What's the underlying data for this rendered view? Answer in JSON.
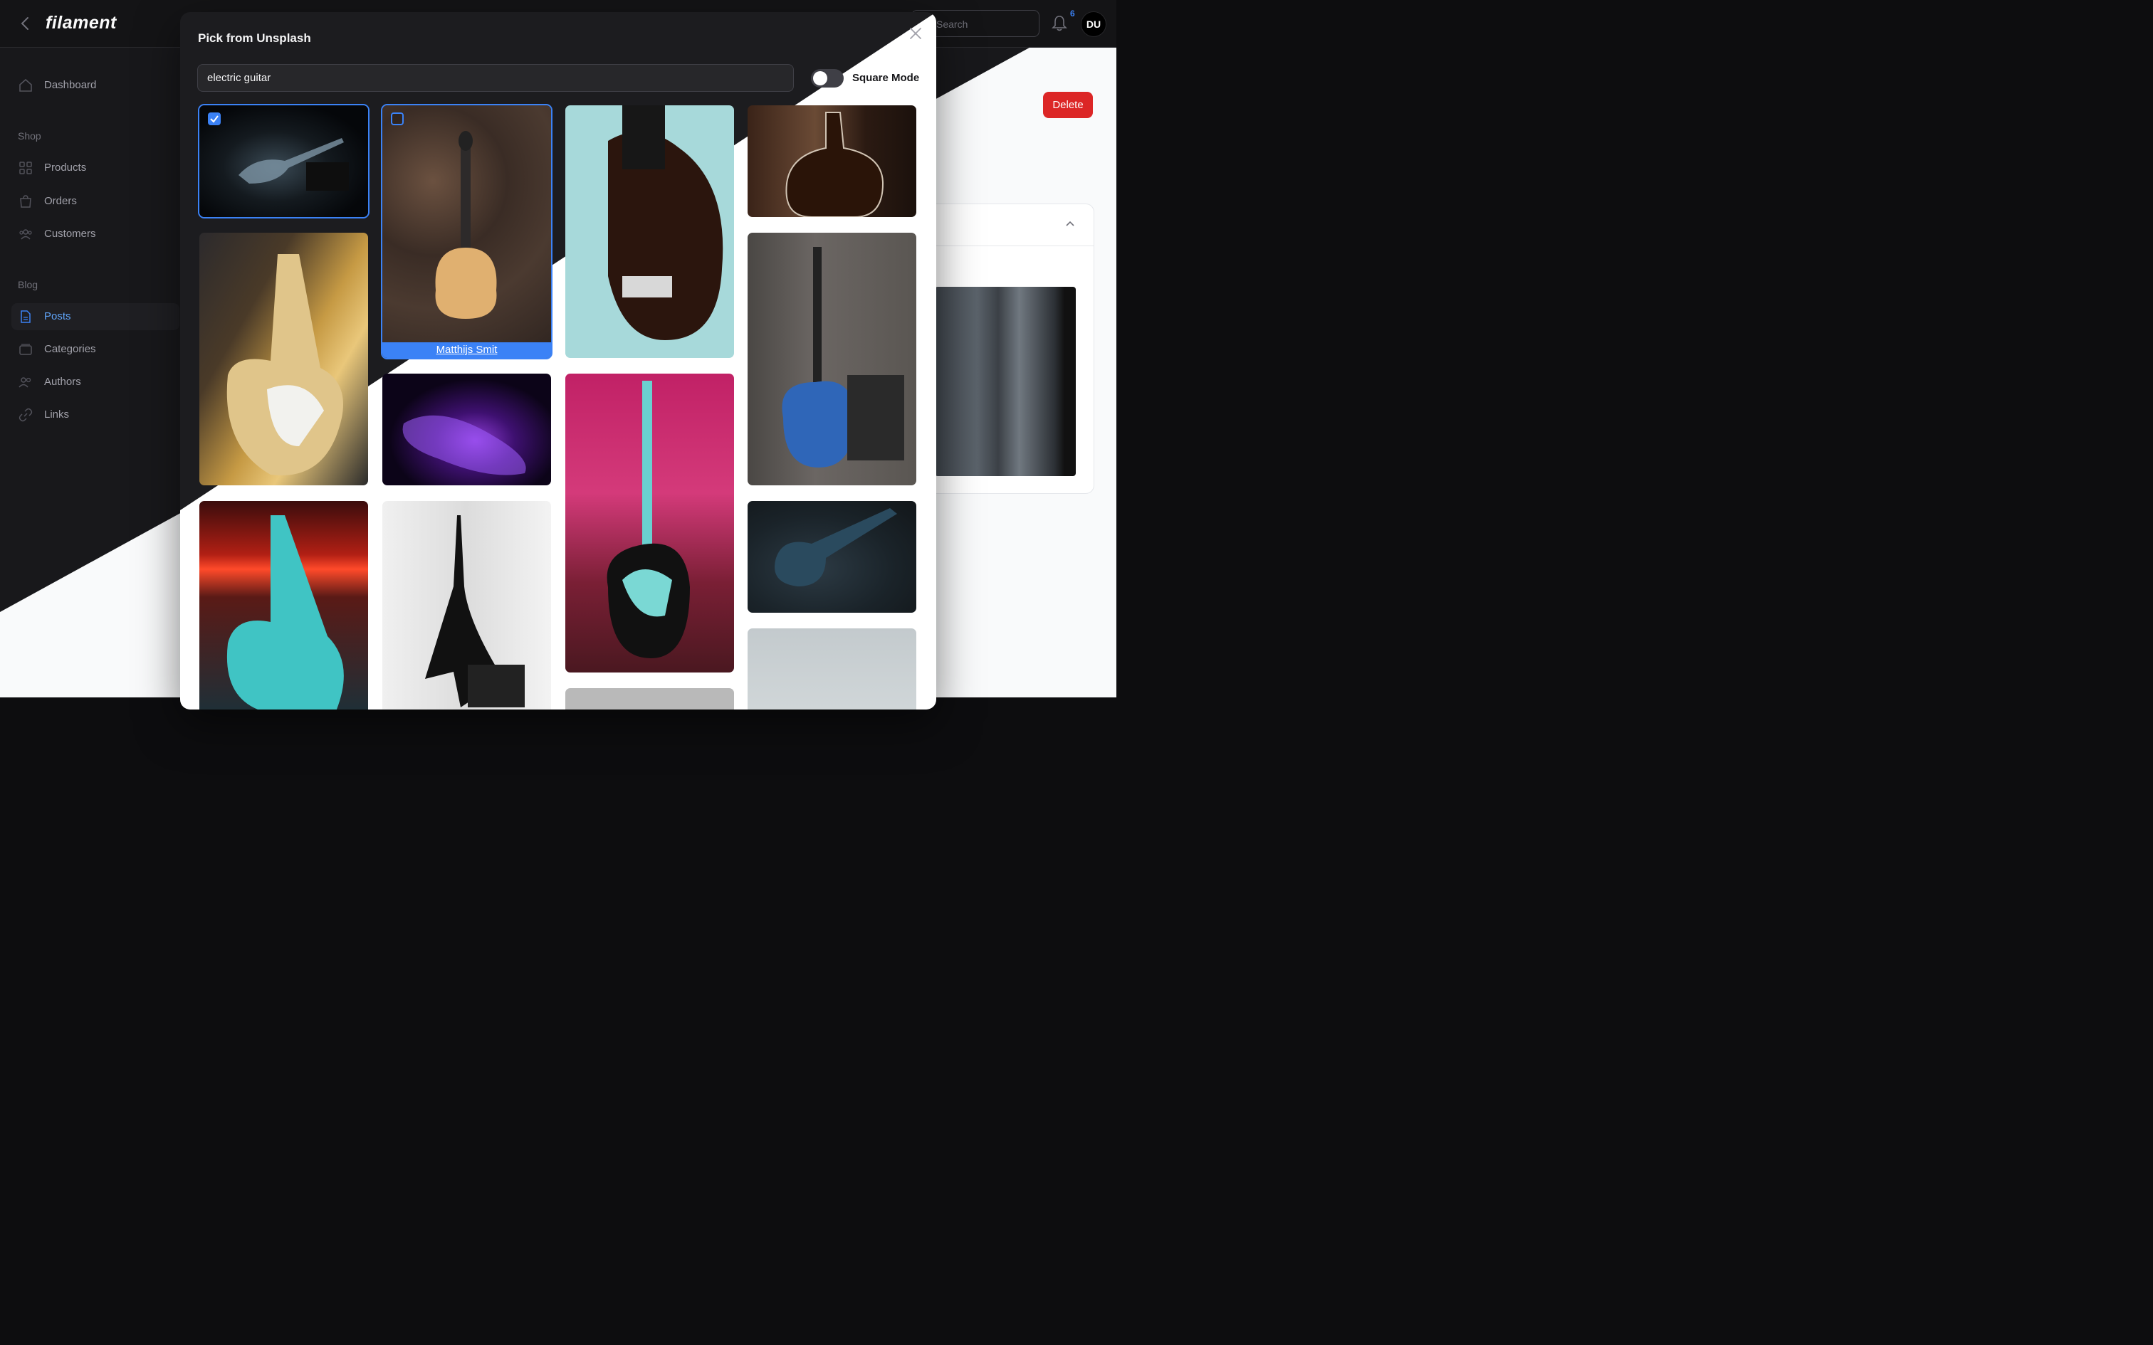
{
  "app": {
    "logo": "filament",
    "search_placeholder": "Search",
    "notification_count": "6",
    "avatar_initials": "DU",
    "accent": "#3b82f6",
    "danger": "#dc2626"
  },
  "sidebar": {
    "items": [
      {
        "label": "Dashboard",
        "icon": "home-icon"
      },
      {
        "label": "Products",
        "icon": "grid-icon"
      },
      {
        "label": "Orders",
        "icon": "shopping-bag-icon"
      },
      {
        "label": "Customers",
        "icon": "users-icon"
      },
      {
        "label": "Posts",
        "icon": "document-icon"
      },
      {
        "label": "Categories",
        "icon": "folder-icon"
      },
      {
        "label": "Authors",
        "icon": "user-group-icon"
      },
      {
        "label": "Links",
        "icon": "link-icon"
      }
    ],
    "groups": [
      "Shop",
      "Blog"
    ],
    "active": "Posts"
  },
  "page": {
    "delete_label": "Delete"
  },
  "modal": {
    "title": "Pick from Unsplash",
    "search_value": "electric guitar",
    "toggle_label": "Square Mode",
    "toggle_on": false,
    "images": [
      {
        "selected": true,
        "theme": "dark-stage"
      },
      {
        "hover": true,
        "theme": "archtop-leaves",
        "credit": "Matthijs Smit"
      },
      {
        "theme": "seafoam-strat-closeup"
      },
      {
        "theme": "hollowbody-wood"
      },
      {
        "theme": "gold-strat-marshall"
      },
      {
        "theme": "purple-neon-guitar"
      },
      {
        "theme": "pink-teal-strat"
      },
      {
        "theme": "blue-burst-amp"
      },
      {
        "theme": "teal-strat-red-light"
      },
      {
        "theme": "black-explorer"
      },
      {
        "theme": "les-paul-dark-floor"
      },
      {
        "theme": "grey-gradient"
      },
      {
        "theme": "grey-loading"
      }
    ]
  }
}
